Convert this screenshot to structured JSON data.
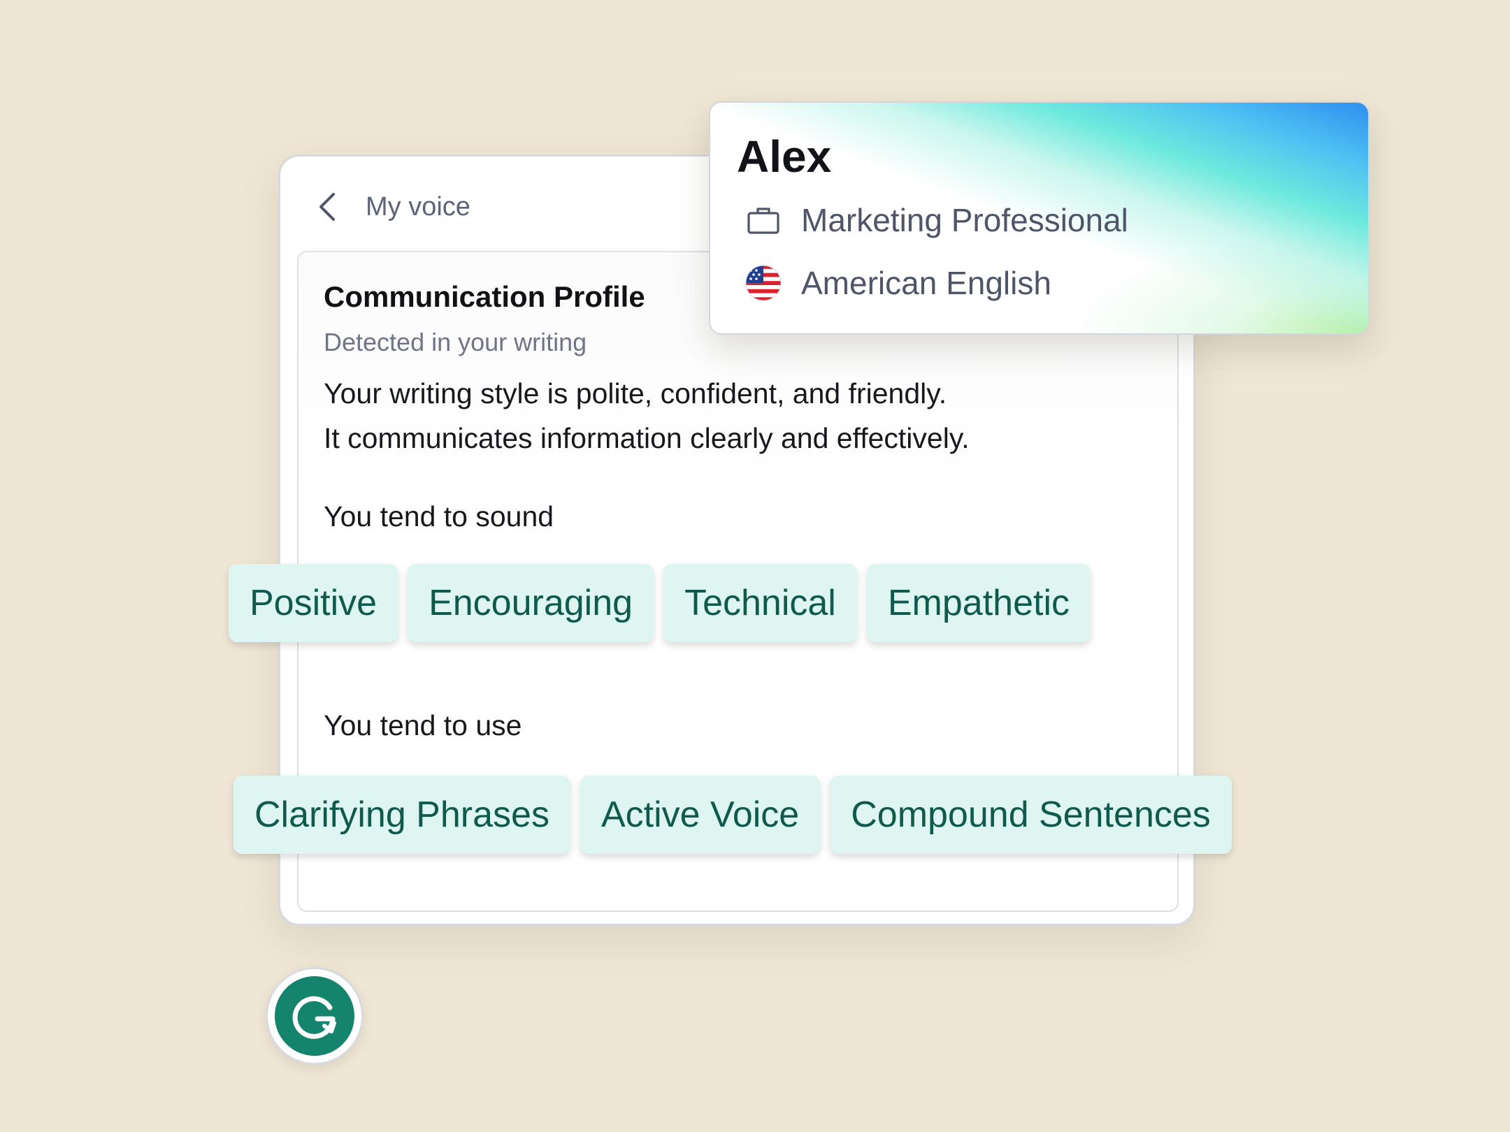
{
  "panel": {
    "back_icon": "chevron-left-icon",
    "title": "My voice"
  },
  "card": {
    "title": "Communication Profile",
    "subtitle": "Detected in your writing",
    "description_lines": [
      "Your writing style is polite, confident, and friendly.",
      "It communicates information clearly and effectively."
    ],
    "sound_label": "You tend to sound",
    "sound_tags": [
      "Positive",
      "Encouraging",
      "Technical",
      "Empathetic"
    ],
    "use_label": "You tend to use",
    "use_tags": [
      "Clarifying Phrases",
      "Active Voice",
      "Compound Sentences"
    ]
  },
  "profile": {
    "name": "Alex",
    "occupation": "Marketing Professional",
    "occupation_icon": "briefcase-icon",
    "language": "American English",
    "language_icon": "us-flag-icon"
  },
  "logo": {
    "icon": "grammarly-logo-icon"
  },
  "colors": {
    "background": "#efe6d5",
    "tag_background": "#dff5f1",
    "tag_text": "#0f5a4c",
    "brand_green": "#15846d"
  }
}
